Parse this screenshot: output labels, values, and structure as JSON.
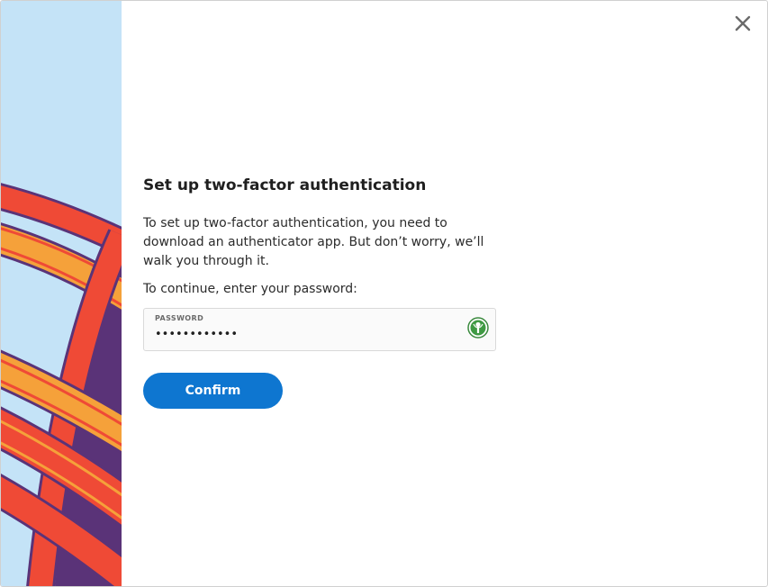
{
  "dialog": {
    "close_icon": "close-icon",
    "title": "Set up two-factor authentication",
    "description": "To set up two-factor authentication, you need to download an authenticator app. But don’t worry, we’ll walk you through it.",
    "prompt": "To continue, enter your password:",
    "password": {
      "label": "PASSWORD",
      "value": "••••••••••••",
      "icon": "keeper-icon"
    },
    "confirm_label": "Confirm"
  },
  "colors": {
    "accent": "#0e76d0",
    "art_sky": "#c4e3f7",
    "art_orange": "#f5a13a",
    "art_red": "#ef4a36",
    "art_purple": "#5a3378"
  }
}
